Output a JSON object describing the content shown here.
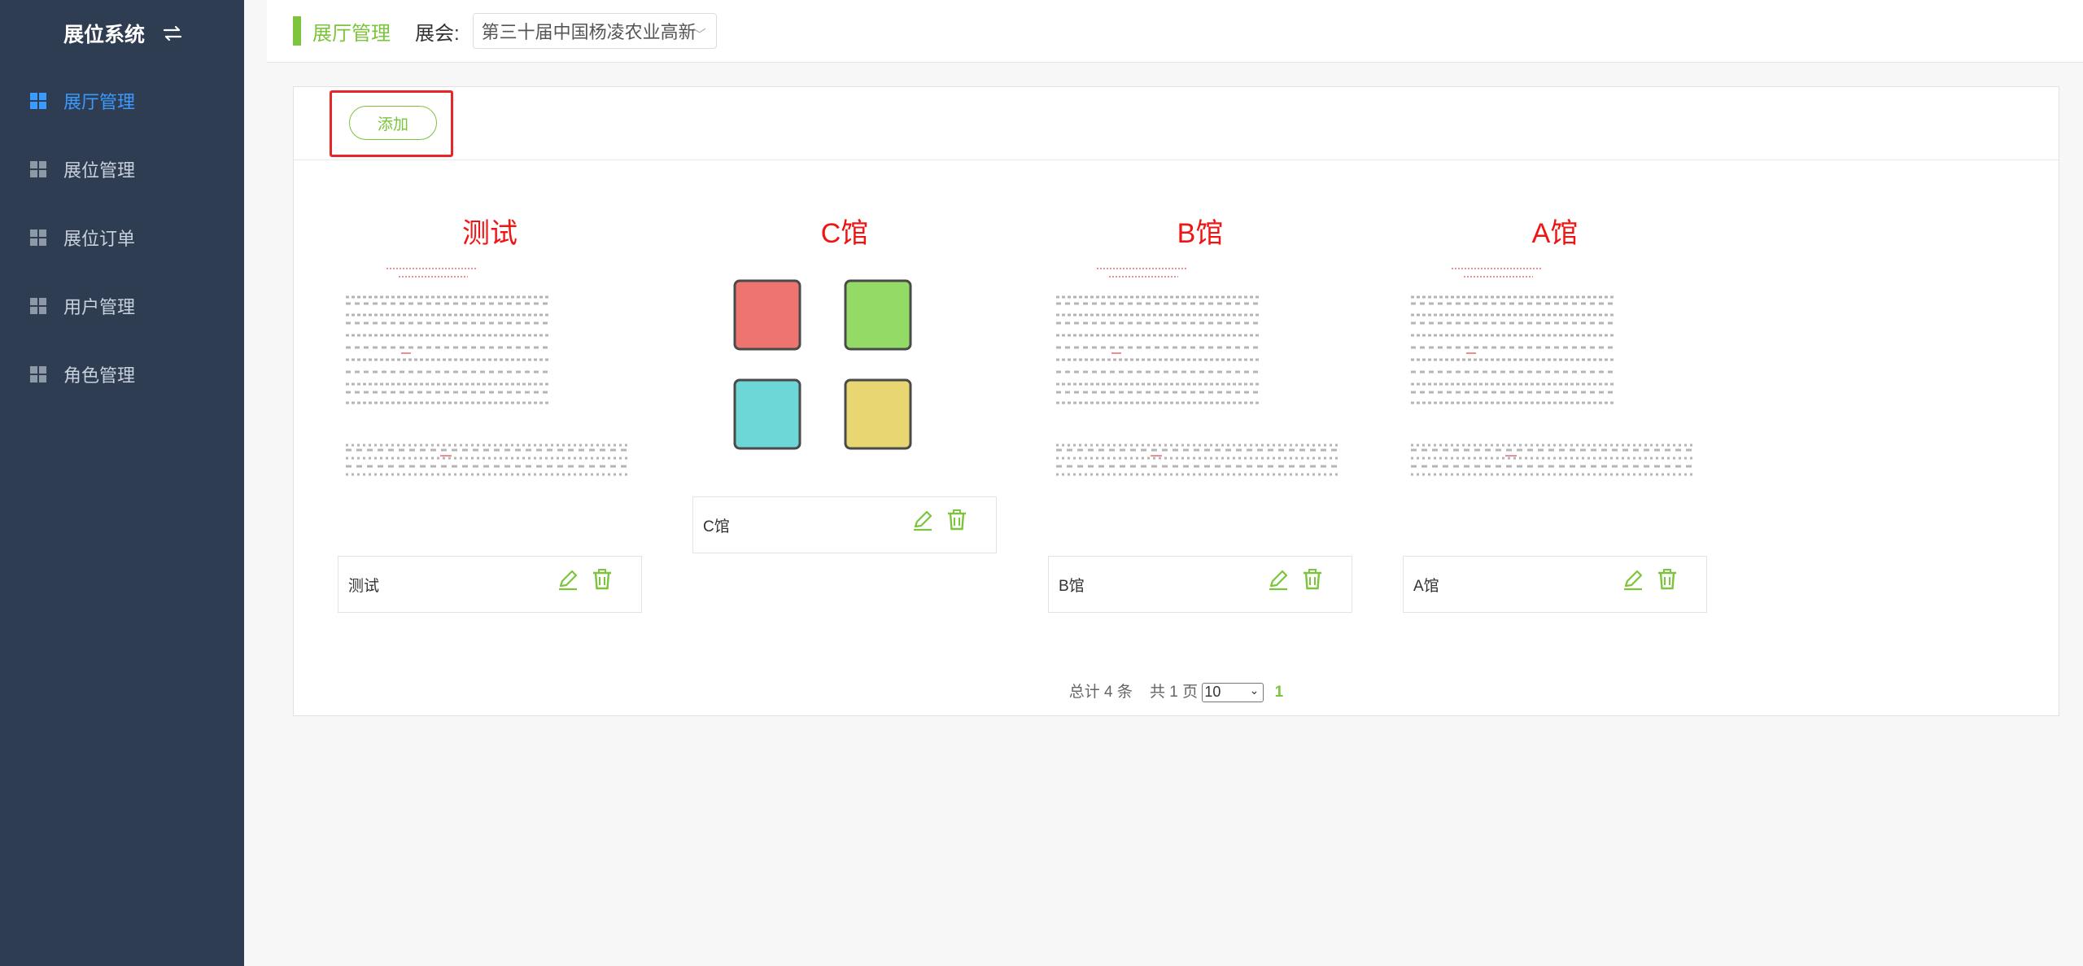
{
  "sidebar": {
    "title": "展位系统",
    "toggle_icon": "swap-icon",
    "items": [
      {
        "label": "展厅管理",
        "icon": "grid-icon",
        "active": true
      },
      {
        "label": "展位管理",
        "icon": "grid-icon",
        "active": false
      },
      {
        "label": "展位订单",
        "icon": "grid-icon",
        "active": false
      },
      {
        "label": "用户管理",
        "icon": "grid-icon",
        "active": false
      },
      {
        "label": "角色管理",
        "icon": "grid-icon",
        "active": false
      }
    ]
  },
  "header": {
    "page_title": "展厅管理",
    "expo_label": "展会:",
    "expo_value": "第三十届中国杨凌农业高新"
  },
  "toolbar": {
    "add_label": "添加"
  },
  "halls": [
    {
      "name": "测试",
      "caption": "测试",
      "plan": "document"
    },
    {
      "name": "C馆",
      "caption": "C馆",
      "plan": "booths"
    },
    {
      "name": "B馆",
      "caption": "B馆",
      "plan": "document"
    },
    {
      "name": "A馆",
      "caption": "A馆",
      "plan": "document"
    }
  ],
  "booth_colors": [
    "#ee7470",
    "#94da66",
    "#6dd6d6",
    "#e8d672"
  ],
  "pager": {
    "total": "总计 4 条",
    "pages": "共 1 页",
    "page_size": "10",
    "current": "1"
  },
  "colors": {
    "accent": "#7cc43b",
    "sidebar_bg": "#2f3d52",
    "active_nav": "#3b9aff",
    "hall_title": "#f01414",
    "highlight": "#e8262a"
  }
}
